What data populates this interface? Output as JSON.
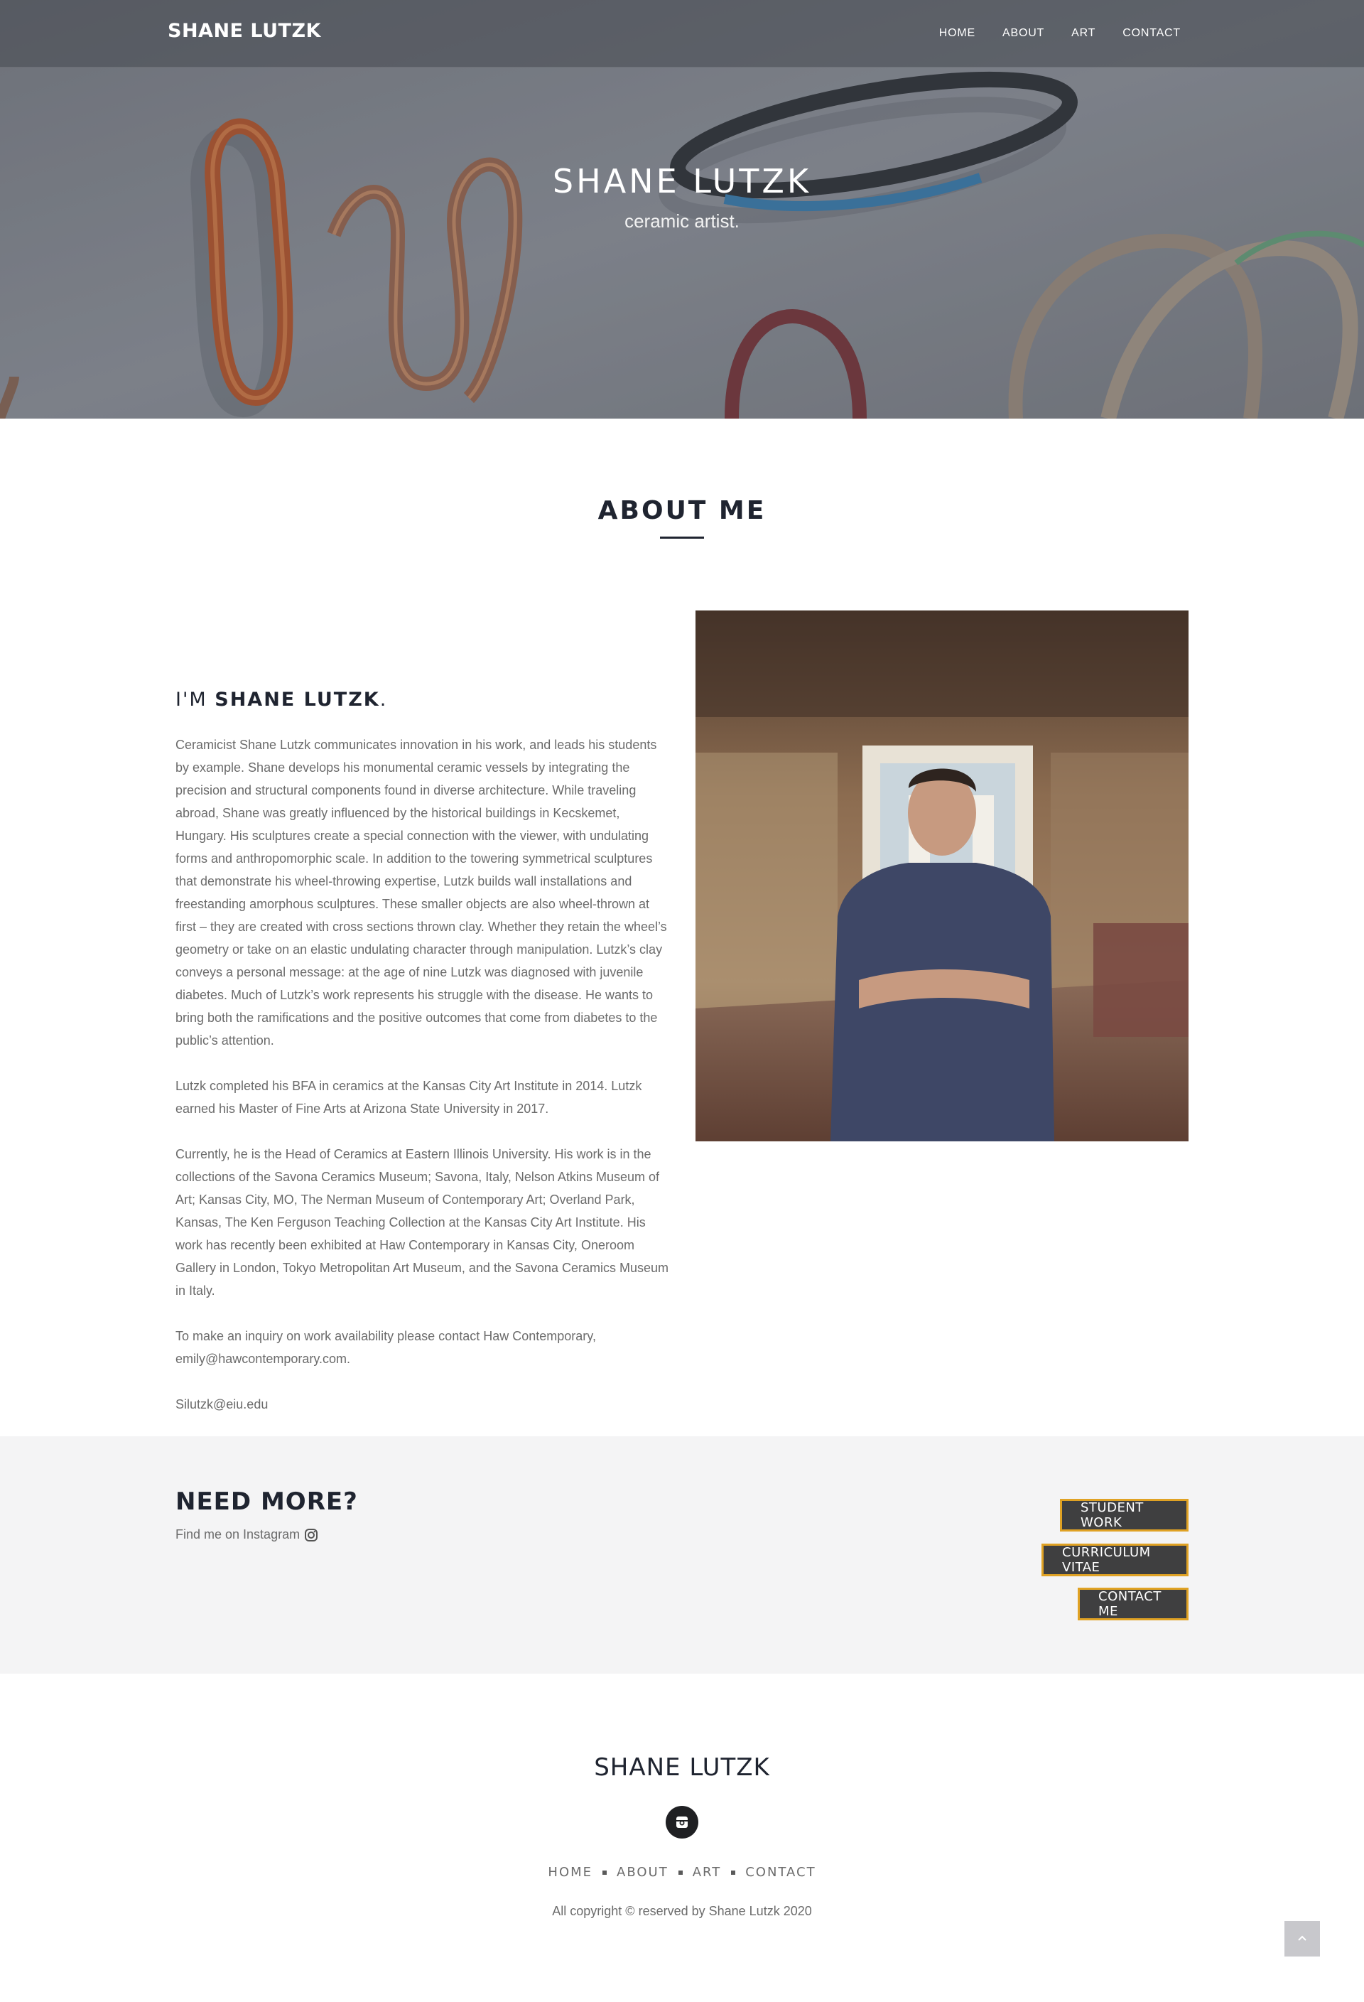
{
  "nav": {
    "brand": "SHANE LUTZK",
    "links": [
      "HOME",
      "ABOUT",
      "ART",
      "CONTACT"
    ]
  },
  "hero": {
    "title": "SHANE LUTZK",
    "subtitle": "ceramic artist."
  },
  "about": {
    "heading": "ABOUT ME",
    "intro_prefix": "I'M ",
    "intro_name": "SHANE LUTZK",
    "intro_suffix": ".",
    "paragraphs": [
      "Ceramicist Shane Lutzk communicates innovation in his work, and leads his students by example. Shane develops his monumental ceramic vessels by integrating the precision and structural components found in diverse architecture. While traveling abroad, Shane was greatly influenced by the historical buildings in Kecskemet, Hungary. His sculptures create a special connection with the viewer, with undulating forms and anthropomorphic scale. In addition to the towering symmetrical sculptures that demonstrate his wheel-throwing expertise, Lutzk builds wall installations and freestanding amorphous sculptures. These smaller objects are also wheel-thrown at first – they are created with cross sections thrown clay. Whether they retain the wheel’s geometry or take on an elastic undulating character through manipulation. Lutzk’s clay conveys a personal message: at the age of nine Lutzk was diagnosed with juvenile diabetes. Much of Lutzk’s work represents his struggle with the disease. He wants to bring both the ramifications and the positive outcomes that come from diabetes to the public’s attention.",
      "Lutzk completed his BFA in ceramics at the Kansas City Art Institute in 2014. Lutzk earned his Master of Fine Arts at Arizona State University in 2017.",
      "Currently, he is the Head of Ceramics at Eastern Illinois University. His work is in the collections of the Savona Ceramics Museum; Savona, Italy, Nelson Atkins Museum of Art; Kansas City, MO, The Nerman Museum of Contemporary Art; Overland Park, Kansas, The Ken Ferguson Teaching Collection at the Kansas City Art Institute. His work has recently been exhibited at Haw Contemporary in Kansas City, Oneroom Gallery in London, Tokyo Metropolitan Art Museum, and the Savona Ceramics Museum in Italy.",
      "To make an inquiry on work availability please contact Haw Contemporary, emily@hawcontemporary.com.",
      "Silutzk@eiu.edu"
    ]
  },
  "need_more": {
    "title": "NEED MORE?",
    "instagram_text": "Find me on Instagram",
    "buttons": [
      "STUDENT WORK",
      "CURRICULUM VITAE",
      "CONTACT ME"
    ]
  },
  "footer": {
    "brand": "SHANE LUTZK",
    "links": [
      "HOME",
      "ABOUT",
      "ART",
      "CONTACT"
    ],
    "copyright": "All copyright © reserved by Shane Lutzk 2020"
  },
  "icons": {
    "instagram": "instagram-icon",
    "back_to_top": "chevron-up-icon"
  },
  "colors": {
    "accent_border": "#e0a224",
    "button_bg": "#3f3f40",
    "heading": "#1f2430",
    "band_bg": "#f4f4f5"
  }
}
